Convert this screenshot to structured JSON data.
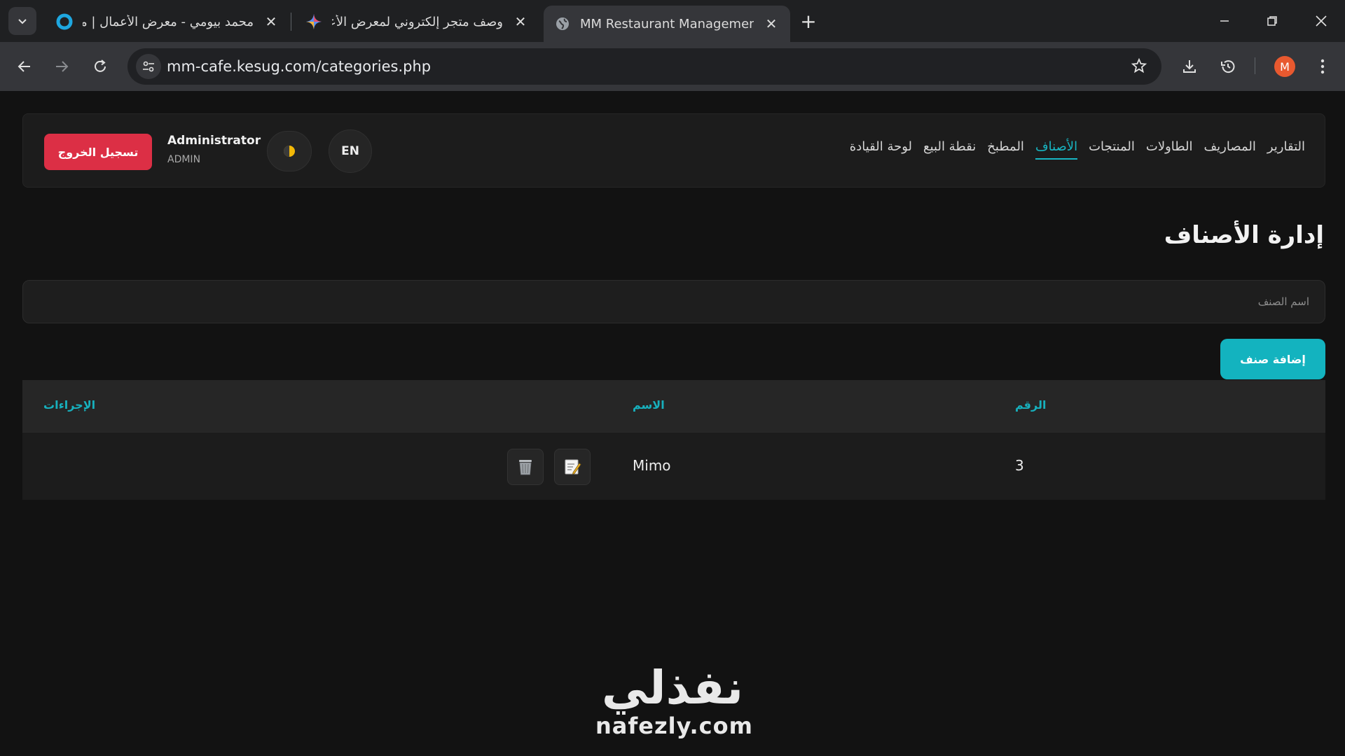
{
  "browser": {
    "tabs": [
      {
        "title": "محمد بيومي - معرض الأعمال | مستقل",
        "active": false
      },
      {
        "title": "وصف متجر إلكتروني لمعرض الأعمال",
        "active": false
      },
      {
        "title": "MM Restaurant Management",
        "active": true
      }
    ],
    "url": "mm-cafe.kesug.com/categories.php",
    "profile_initial": "M",
    "profile_color": "#e8592f"
  },
  "navbar": {
    "logout_label": "تسجيل الخروج",
    "user_name": "Administrator",
    "user_role": "ADMIN",
    "lang_label": "EN",
    "menu": [
      {
        "label": "لوحة القيادة",
        "active": false
      },
      {
        "label": "نقطة البيع",
        "active": false
      },
      {
        "label": "المطبخ",
        "active": false
      },
      {
        "label": "الأصناف",
        "active": true
      },
      {
        "label": "المنتجات",
        "active": false
      },
      {
        "label": "الطاولات",
        "active": false
      },
      {
        "label": "المصاريف",
        "active": false
      },
      {
        "label": "التقارير",
        "active": false
      }
    ]
  },
  "main": {
    "title": "إدارة الأصناف",
    "name_placeholder": "اسم الصنف",
    "add_label": "إضافة صنف",
    "table": {
      "headers": {
        "id": "الرقم",
        "name": "الاسم",
        "actions": "الإجراءات"
      },
      "rows": [
        {
          "id": "3",
          "name": "Mimo"
        }
      ]
    }
  },
  "watermark": {
    "arabic": "نفذلي",
    "latin": "nafezly.com"
  },
  "colors": {
    "accent": "#13b3bf",
    "danger": "#dc2f45",
    "background": "#121212"
  }
}
